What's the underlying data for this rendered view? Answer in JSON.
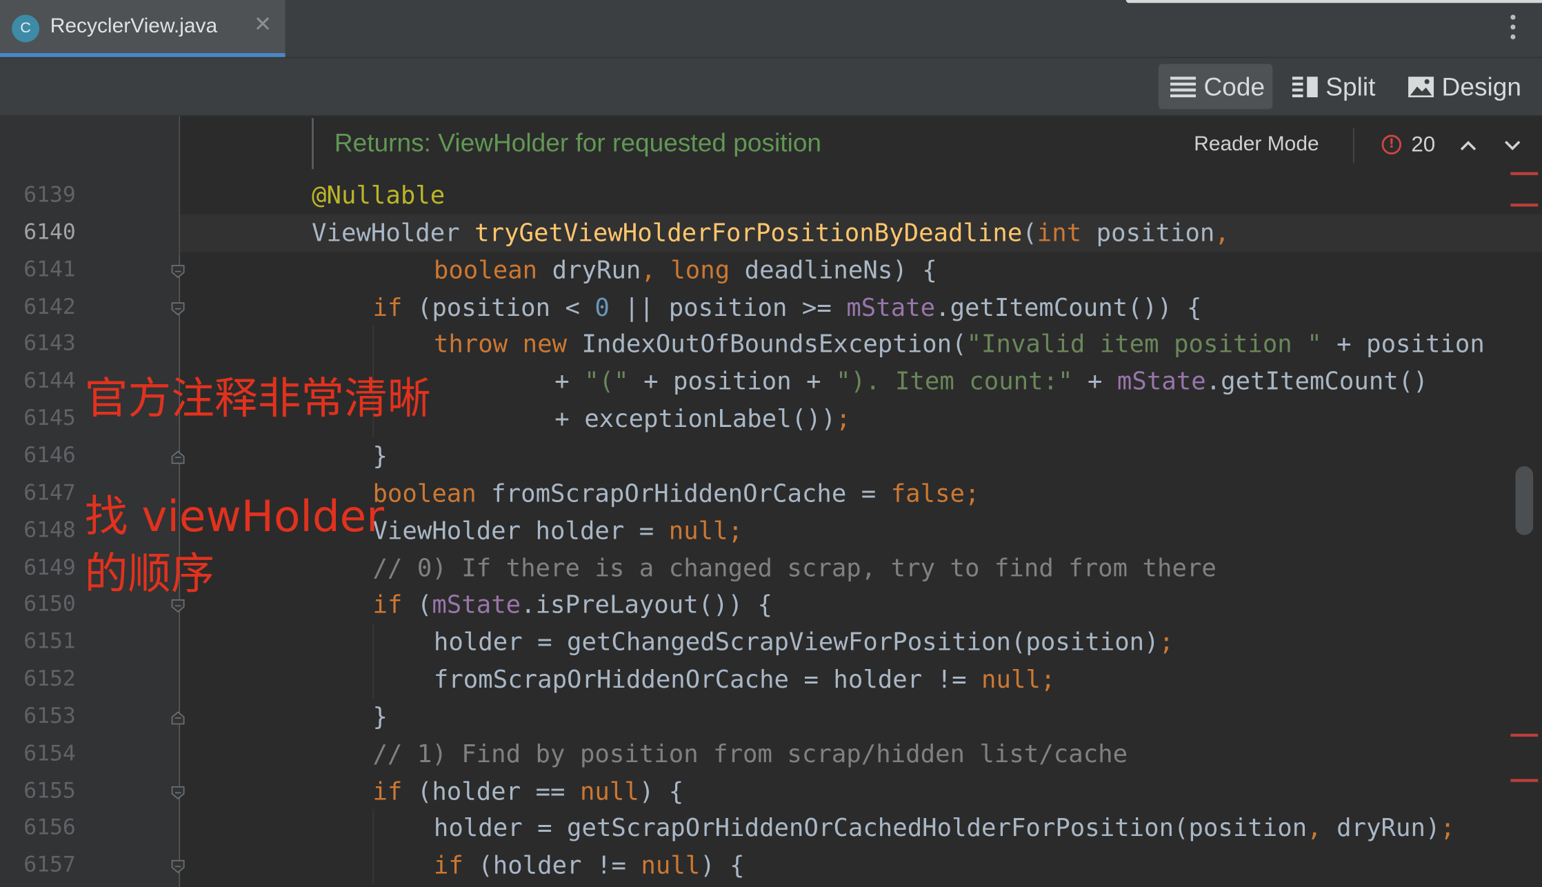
{
  "tab": {
    "title": "RecyclerView.java",
    "icon_letter": "C",
    "close": "✕"
  },
  "view_modes": [
    {
      "label": "Code",
      "icon": "lines-icon",
      "active": true
    },
    {
      "label": "Split",
      "icon": "split-icon",
      "active": false
    },
    {
      "label": "Design",
      "icon": "image-icon",
      "active": false
    }
  ],
  "doc_popup": {
    "text": "Returns: ViewHolder for requested position",
    "reader_mode": "Reader Mode",
    "error_count": "20"
  },
  "line_numbers": [
    "6139",
    "6140",
    "6141",
    "6142",
    "6143",
    "6144",
    "6145",
    "6146",
    "6147",
    "6148",
    "6149",
    "6150",
    "6151",
    "6152",
    "6153",
    "6154",
    "6155",
    "6156",
    "6157"
  ],
  "current_line": "6140",
  "code_lines": [
    [
      [
        "a",
        "@Nullable"
      ]
    ],
    [
      [
        "d",
        "ViewHolder "
      ],
      [
        "m",
        "tryGetViewHolderForPositionByDeadline"
      ],
      [
        "d",
        "("
      ],
      [
        "k",
        "int "
      ],
      [
        "d",
        "position"
      ],
      [
        "k",
        ","
      ]
    ],
    [
      [
        "k",
        "boolean "
      ],
      [
        "d",
        "dryRun"
      ],
      [
        "k",
        ", "
      ],
      [
        "k",
        "long "
      ],
      [
        "d",
        "deadlineNs) {"
      ]
    ],
    [
      [
        "k",
        "if "
      ],
      [
        "d",
        "(position < "
      ],
      [
        "n",
        "0 "
      ],
      [
        "d",
        "|| position >= "
      ],
      [
        "f",
        "mState"
      ],
      [
        "d",
        ".getItemCount()) {"
      ]
    ],
    [
      [
        "k",
        "throw new "
      ],
      [
        "d",
        "IndexOutOfBoundsException("
      ],
      [
        "s",
        "\"Invalid item position \" "
      ],
      [
        "d",
        "+ position"
      ]
    ],
    [
      [
        "d",
        "+ "
      ],
      [
        "s",
        "\"(\" "
      ],
      [
        "d",
        "+ position + "
      ],
      [
        "s",
        "\"). Item count:\" "
      ],
      [
        "d",
        "+ "
      ],
      [
        "f",
        "mState"
      ],
      [
        "d",
        ".getItemCount()"
      ]
    ],
    [
      [
        "d",
        "+ exceptionLabel())"
      ],
      [
        "k",
        ";"
      ]
    ],
    [
      [
        "d",
        "}"
      ]
    ],
    [
      [
        "k",
        "boolean "
      ],
      [
        "d",
        "fromScrapOrHiddenOrCache = "
      ],
      [
        "k",
        "false;"
      ]
    ],
    [
      [
        "d",
        "ViewHolder holder = "
      ],
      [
        "k",
        "null;"
      ]
    ],
    [
      [
        "c",
        "// 0) If there is a changed scrap, try to find from there"
      ]
    ],
    [
      [
        "k",
        "if "
      ],
      [
        "d",
        "("
      ],
      [
        "f",
        "mState"
      ],
      [
        "d",
        ".isPreLayout()) {"
      ]
    ],
    [
      [
        "d",
        "holder = getChangedScrapViewForPosition(position)"
      ],
      [
        "k",
        ";"
      ]
    ],
    [
      [
        "d",
        "fromScrapOrHiddenOrCache = holder != "
      ],
      [
        "k",
        "null;"
      ]
    ],
    [
      [
        "d",
        "}"
      ]
    ],
    [
      [
        "c",
        "// 1) Find by position from scrap/hidden list/cache"
      ]
    ],
    [
      [
        "k",
        "if "
      ],
      [
        "d",
        "(holder == "
      ],
      [
        "k",
        "null"
      ],
      [
        "d",
        ") {"
      ]
    ],
    [
      [
        "d",
        "holder = getScrapOrHiddenOrCachedHolderForPosition(position"
      ],
      [
        "k",
        ", "
      ],
      [
        "d",
        "dryRun)"
      ],
      [
        "k",
        ";"
      ]
    ],
    [
      [
        "k",
        "if "
      ],
      [
        "d",
        "(holder != "
      ],
      [
        "k",
        "null"
      ],
      [
        "d",
        ") {"
      ]
    ]
  ],
  "annotations": [
    "官方注释非常清晰",
    "找 viewHolder",
    "的顺序"
  ],
  "colors": {
    "background": "#2b2b2b",
    "keyword": "#cc7832",
    "string": "#6a8759",
    "number": "#6897bb",
    "field": "#9876aa",
    "method": "#ffc66d",
    "annotation": "#bbb529",
    "comment": "#808080",
    "doc_text": "#629755",
    "error_marker": "#bc3f3c",
    "annotation_overlay": "#e1321e"
  }
}
